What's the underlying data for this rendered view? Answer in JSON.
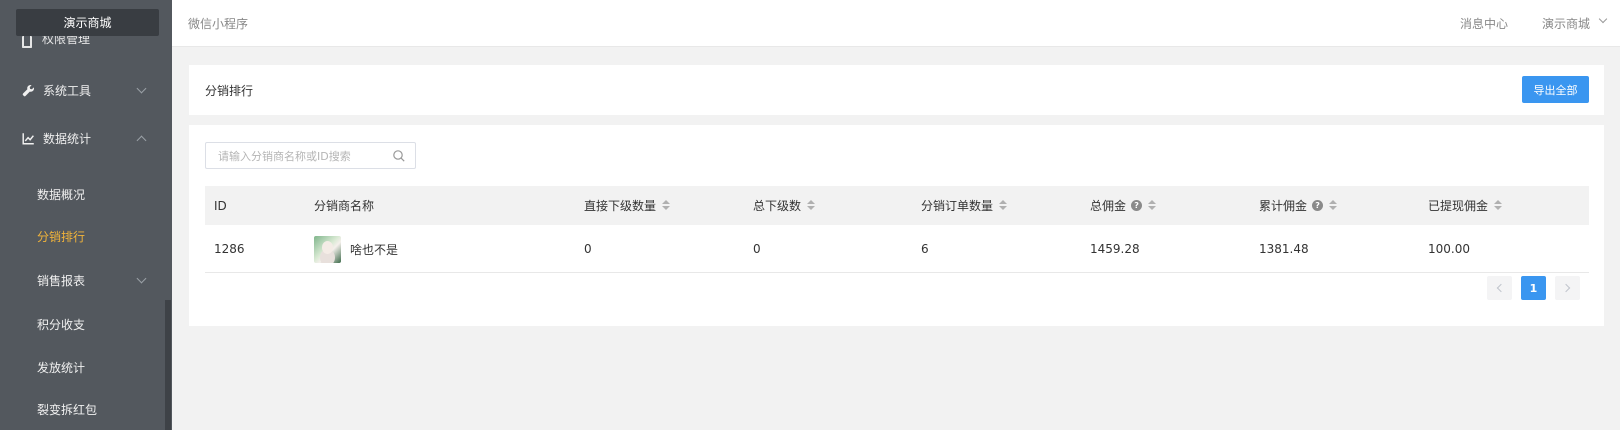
{
  "sidebar": {
    "shop_name": "演示商城",
    "partial_item_label": "权限管理",
    "menus": [
      {
        "label": "系统工具",
        "icon": "wrench-icon",
        "expanded": false
      },
      {
        "label": "数据统计",
        "icon": "line-chart-icon",
        "expanded": true
      }
    ],
    "sub_items": [
      {
        "label": "数据概况",
        "active": false,
        "has_children": false
      },
      {
        "label": "分销排行",
        "active": true,
        "has_children": false
      },
      {
        "label": "销售报表",
        "active": false,
        "has_children": true
      },
      {
        "label": "积分收支",
        "active": false,
        "has_children": false
      },
      {
        "label": "发放统计",
        "active": false,
        "has_children": false
      },
      {
        "label": "裂变拆红包",
        "active": false,
        "has_children": false
      }
    ],
    "active_color": "#f2b43a"
  },
  "header": {
    "breadcrumb": "微信小程序",
    "message_center": "消息中心",
    "store_menu": "演示商城"
  },
  "page": {
    "title": "分销排行",
    "export_label": "导出全部",
    "accent_color": "#3a96f0"
  },
  "search": {
    "placeholder": "请输入分销商名称或ID搜索",
    "value": ""
  },
  "table": {
    "columns": [
      {
        "label": "ID",
        "sortable": false,
        "help": false
      },
      {
        "label": "分销商名称",
        "sortable": false,
        "help": false
      },
      {
        "label": "直接下级数量",
        "sortable": true,
        "help": false
      },
      {
        "label": "总下级数",
        "sortable": true,
        "help": false
      },
      {
        "label": "分销订单数量",
        "sortable": true,
        "help": false
      },
      {
        "label": "总佣金",
        "sortable": true,
        "help": true
      },
      {
        "label": "累计佣金",
        "sortable": true,
        "help": true
      },
      {
        "label": "已提现佣金",
        "sortable": true,
        "help": false
      }
    ],
    "rows": [
      {
        "id": "1286",
        "name": "啥也不是",
        "direct_subordinates": "0",
        "total_subordinates": "0",
        "orders": "6",
        "total_commission": "1459.28",
        "cumulative_commission": "1381.48",
        "withdrawn_commission": "100.00"
      }
    ]
  },
  "pagination": {
    "current_page": "1",
    "prev_icon": "chevron-left-icon",
    "next_icon": "chevron-right-icon"
  }
}
